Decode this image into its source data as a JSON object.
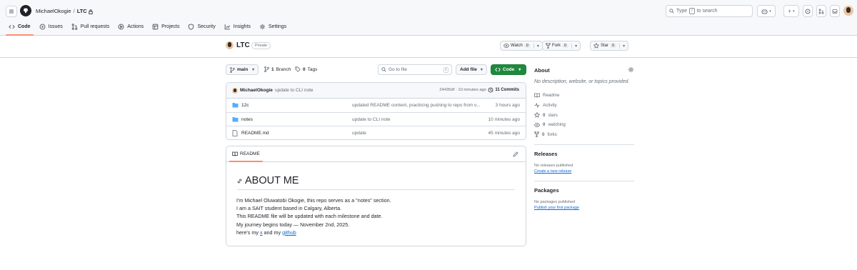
{
  "header": {
    "owner": "MichaelOkogie",
    "separator": "/",
    "repo": "LTC",
    "search_placeholder_prefix": "Type",
    "search_key": "/",
    "search_placeholder_suffix": "to search"
  },
  "nav_tabs": [
    {
      "label": "Code",
      "icon": "code-icon"
    },
    {
      "label": "Issues",
      "icon": "issue-icon"
    },
    {
      "label": "Pull requests",
      "icon": "pull-request-icon"
    },
    {
      "label": "Actions",
      "icon": "play-icon"
    },
    {
      "label": "Projects",
      "icon": "table-icon"
    },
    {
      "label": "Security",
      "icon": "shield-icon"
    },
    {
      "label": "Insights",
      "icon": "graph-icon"
    },
    {
      "label": "Settings",
      "icon": "gear-icon"
    }
  ],
  "repo_header": {
    "name": "LTC",
    "visibility": "Private",
    "watch_label": "Watch",
    "watch_count": "0",
    "fork_label": "Fork",
    "fork_count": "0",
    "star_label": "Star",
    "star_count": "0"
  },
  "toolbar": {
    "branch": "main",
    "branch_count": "1",
    "branch_label": "Branch",
    "tag_count": "0",
    "tag_label": "Tags",
    "goto_placeholder": "Go to file",
    "goto_key": "t",
    "add_file_label": "Add file",
    "code_label": "Code"
  },
  "latest_commit": {
    "author": "MichaelOkogie",
    "message": "update to CLI note",
    "meta": "24435df · 10 minutes ago",
    "commits_label": "11 Commits"
  },
  "files": [
    {
      "name": "12c",
      "type": "folder",
      "message": "updated README content, practicing pushing to repo from v...",
      "age": "3 hours ago"
    },
    {
      "name": "notes",
      "type": "folder",
      "message": "update to CLI note",
      "age": "10 minutes ago"
    },
    {
      "name": "README.md",
      "type": "file",
      "message": "update",
      "age": "45 minutes ago"
    }
  ],
  "readme": {
    "tab_label": "README",
    "heading": "ABOUT ME",
    "lines": [
      "I'm Michael Oluwatobi Okogie, this repo serves as a \"notes\" section.",
      "I am a SAIT student based in Calgary, Alberta.",
      "This README file will be updated with each milestone and date.",
      "My journey begins today — November 2nd, 2025."
    ],
    "last_line_prefix": "here's my",
    "link_x": "x",
    "last_line_mid": "and my",
    "link_github": "github"
  },
  "sidebar": {
    "about_title": "About",
    "about_desc": "No description, website, or topics provided.",
    "readme_label": "Readme",
    "activity_label": "Activity",
    "stars_count": "0",
    "stars_label": "stars",
    "watching_count": "0",
    "watching_label": "watching",
    "forks_count": "0",
    "forks_label": "forks",
    "releases_title": "Releases",
    "releases_none": "No releases published",
    "releases_link": "Create a new release",
    "packages_title": "Packages",
    "packages_none": "No packages published",
    "packages_link": "Publish your first package"
  },
  "colors": {
    "accent_green": "#1f883d",
    "link_blue": "#0969da",
    "tab_underline": "#fd8c73",
    "folder_blue": "#54aeff"
  }
}
